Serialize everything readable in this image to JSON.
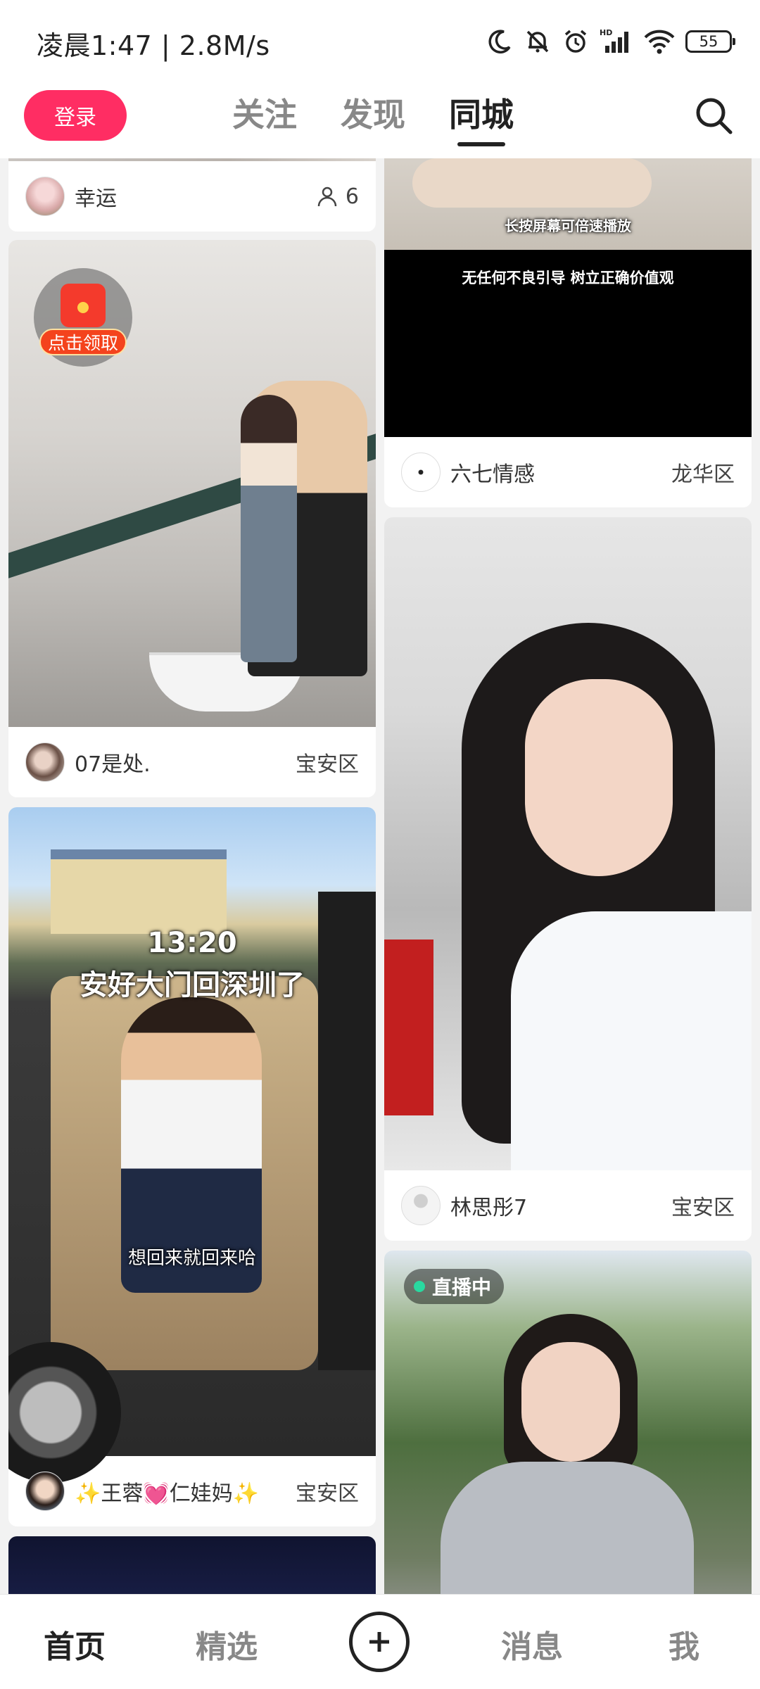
{
  "status_bar": {
    "time": "凌晨1:47 | 2.8M/s",
    "battery": "55",
    "icons": [
      "moon-icon",
      "bell-off-icon",
      "alarm-icon",
      "hd-signal-icon",
      "wifi-icon",
      "battery-icon"
    ]
  },
  "header": {
    "login_label": "登录",
    "tabs": [
      {
        "label": "关注",
        "active": false
      },
      {
        "label": "发现",
        "active": false
      },
      {
        "label": "同城",
        "active": true
      }
    ],
    "search_icon": "search-icon"
  },
  "feed": {
    "cards": [
      {
        "author": "幸运",
        "people_count": "6"
      },
      {
        "author": "07是处.",
        "location": "宝安区",
        "badge_label": "点击领取"
      },
      {
        "author": "✨王蓉💓仁娃妈✨",
        "location": "宝安区",
        "overlay_time": "13:20",
        "overlay_title": "安好大门回深圳了",
        "overlay_caption": "想回来就回来哈"
      },
      {
        "author": "六七情感",
        "location": "龙华区",
        "overlay_hint": "长按屏幕可倍速播放",
        "overlay_notice": "无任何不良引导 树立正确价值观"
      },
      {
        "author": "林思彤7",
        "location": "宝安区"
      },
      {
        "live_label": "直播中"
      }
    ]
  },
  "bottom_nav": {
    "items": [
      {
        "label": "首页",
        "active": true
      },
      {
        "label": "精选",
        "active": false
      },
      {
        "label": "消息",
        "active": false
      },
      {
        "label": "我",
        "active": false
      }
    ],
    "plus_icon": "plus-icon"
  },
  "colors": {
    "accent": "#ff2d63",
    "live_dot": "#29d9a0",
    "background": "#f2f2f2"
  }
}
